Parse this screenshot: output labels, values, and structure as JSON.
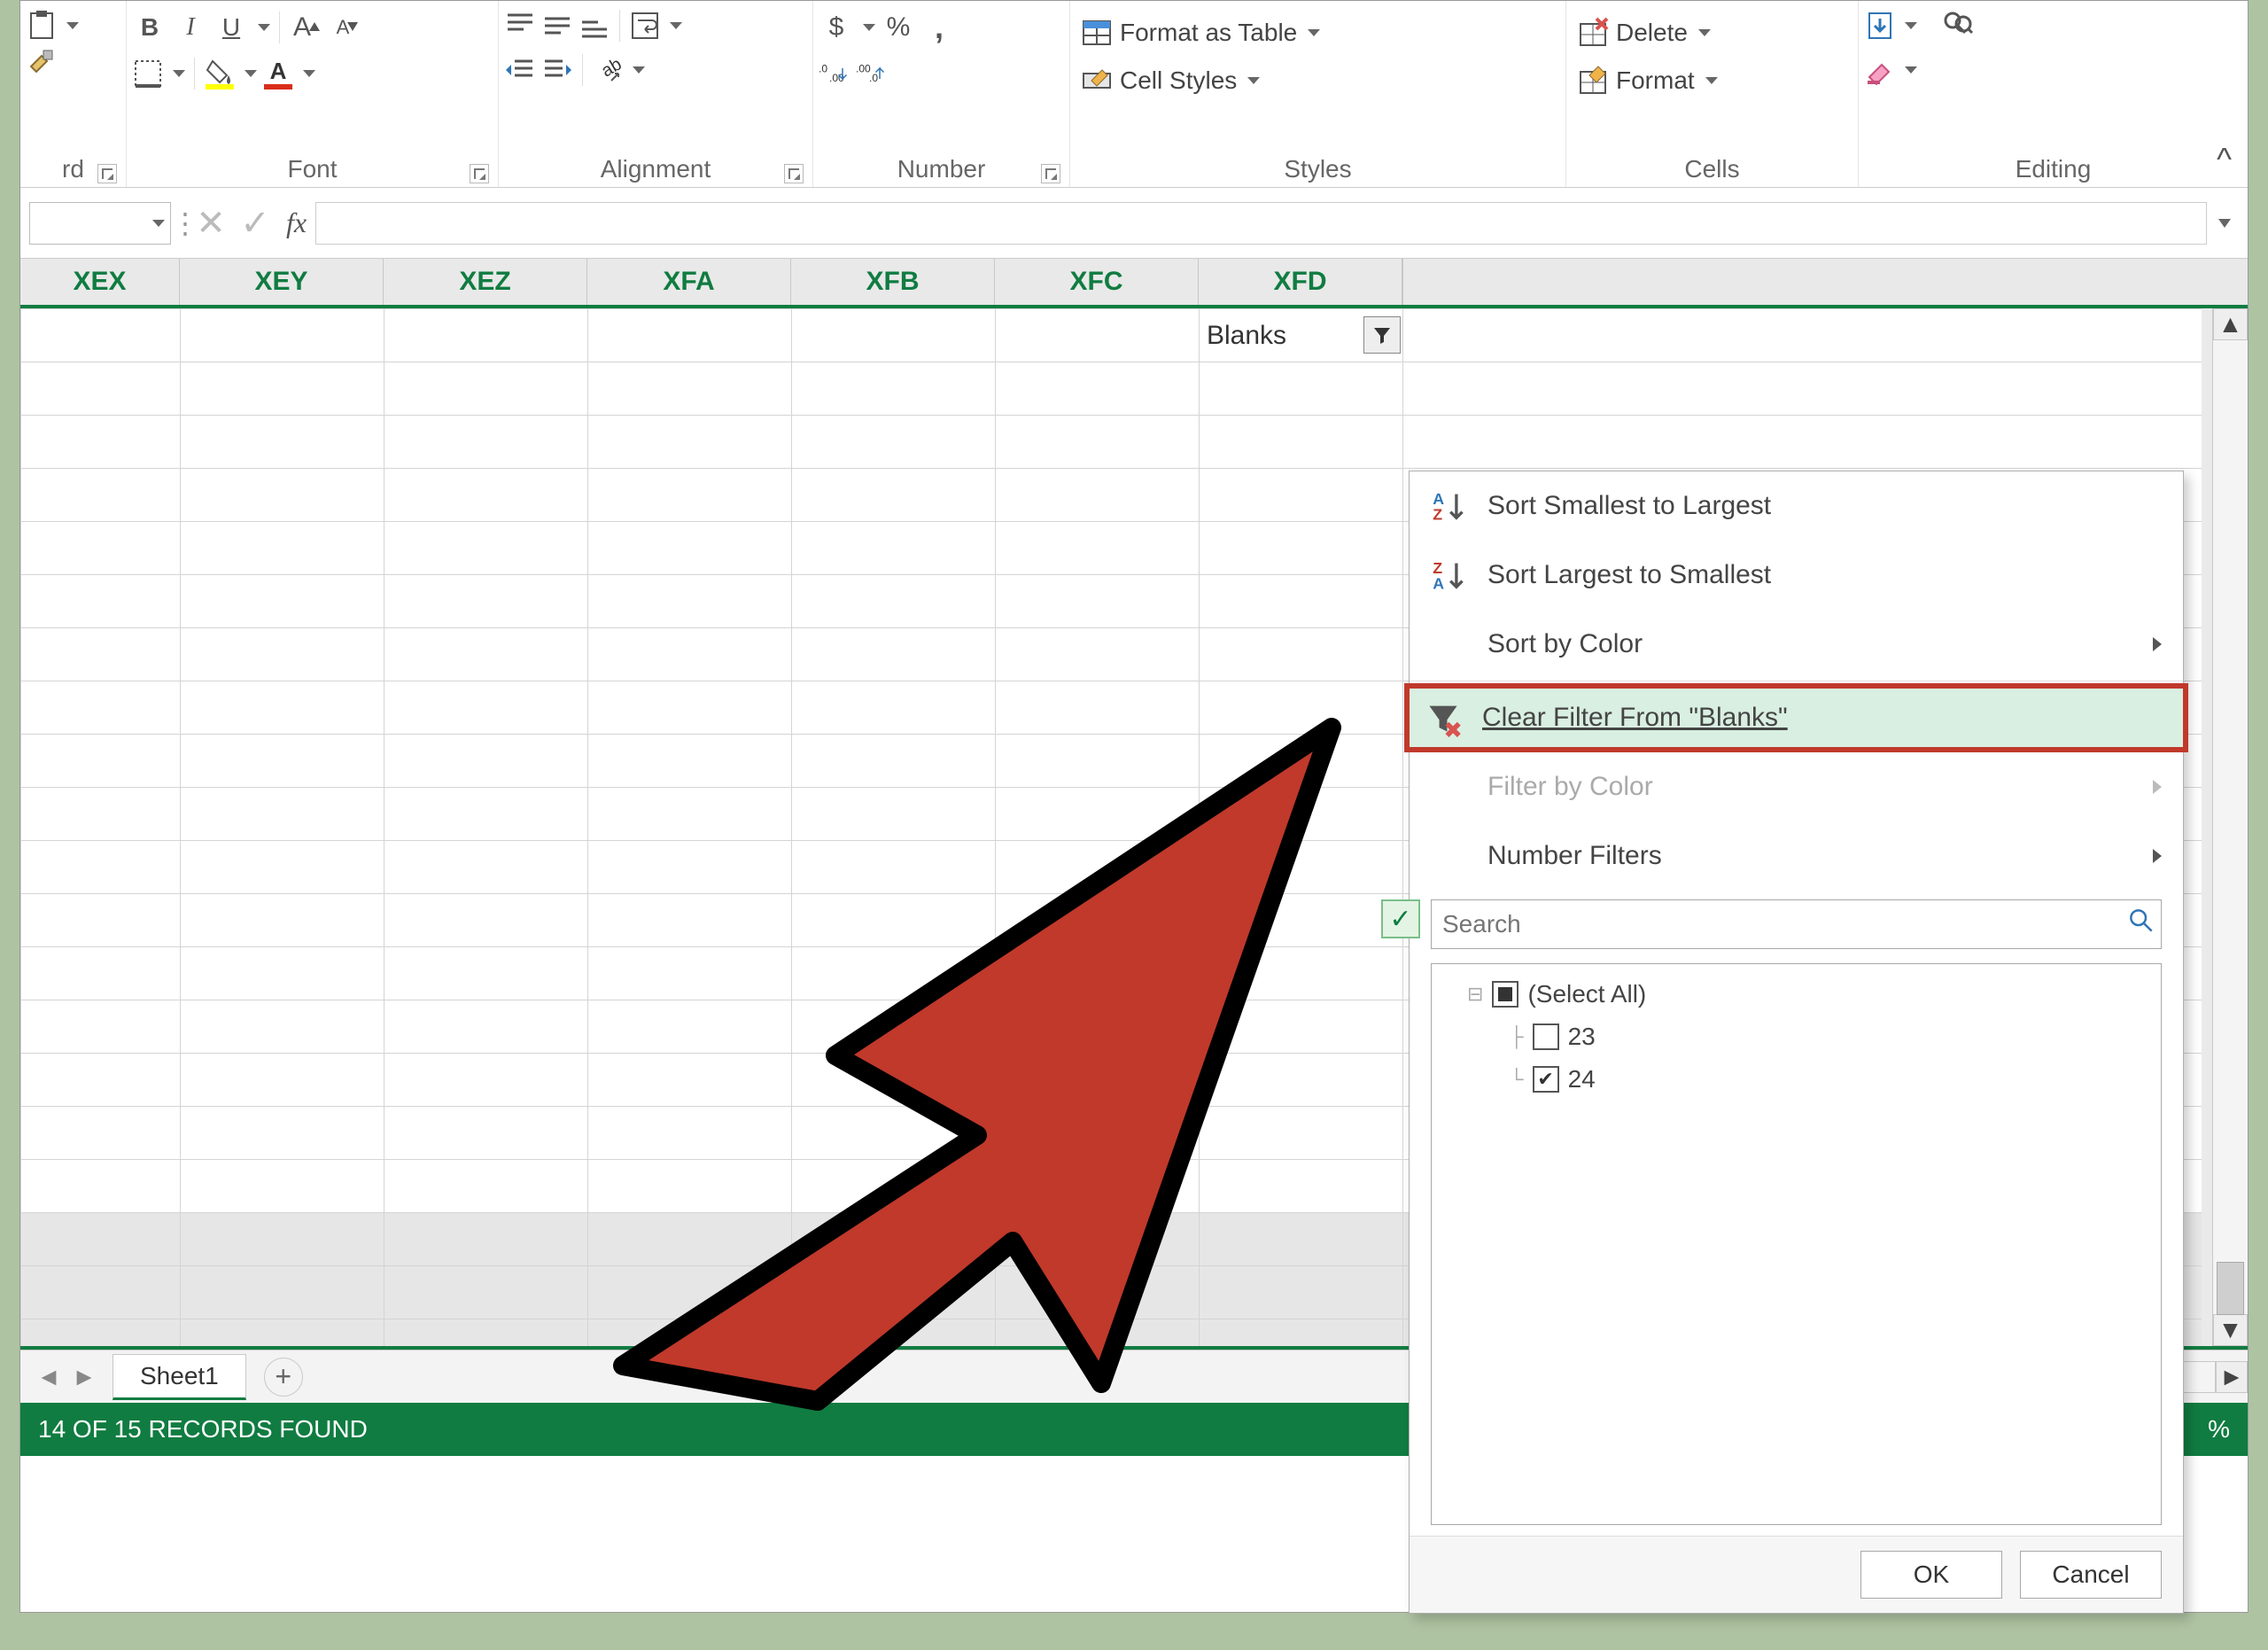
{
  "ribbon": {
    "clipboard": {
      "label": "rd"
    },
    "font": {
      "label": "Font",
      "bold": "B",
      "italic": "I",
      "underline": "U",
      "grow_font": "A",
      "shrink_font": "A"
    },
    "alignment": {
      "label": "Alignment"
    },
    "number": {
      "label": "Number",
      "currency": "$",
      "percent": "%",
      "comma": ","
    },
    "styles": {
      "label": "Styles",
      "format_as_table": "Format as Table",
      "cell_styles": "Cell Styles"
    },
    "cells": {
      "label": "Cells",
      "delete": "Delete",
      "format": "Format"
    },
    "editing": {
      "label": "Editing"
    }
  },
  "formula_bar": {
    "fx": "fx",
    "value": ""
  },
  "columns": [
    "XEX",
    "XEY",
    "XEZ",
    "XFA",
    "XFB",
    "XFC",
    "XFD"
  ],
  "header_cell_value": "Blanks",
  "sheet": {
    "active": "Sheet1"
  },
  "status": {
    "text": "14 OF 15 RECORDS FOUND",
    "zoom": "%"
  },
  "filter_menu": {
    "sort_asc": "Sort Smallest to Largest",
    "sort_desc": "Sort Largest to Smallest",
    "sort_color": "Sort by Color",
    "clear_filter": "Clear Filter From \"Blanks\"",
    "filter_color": "Filter by Color",
    "number_filters": "Number Filters",
    "search_placeholder": "Search",
    "select_all": "(Select All)",
    "items": [
      "23",
      "24"
    ],
    "ok": "OK",
    "cancel": "Cancel"
  }
}
